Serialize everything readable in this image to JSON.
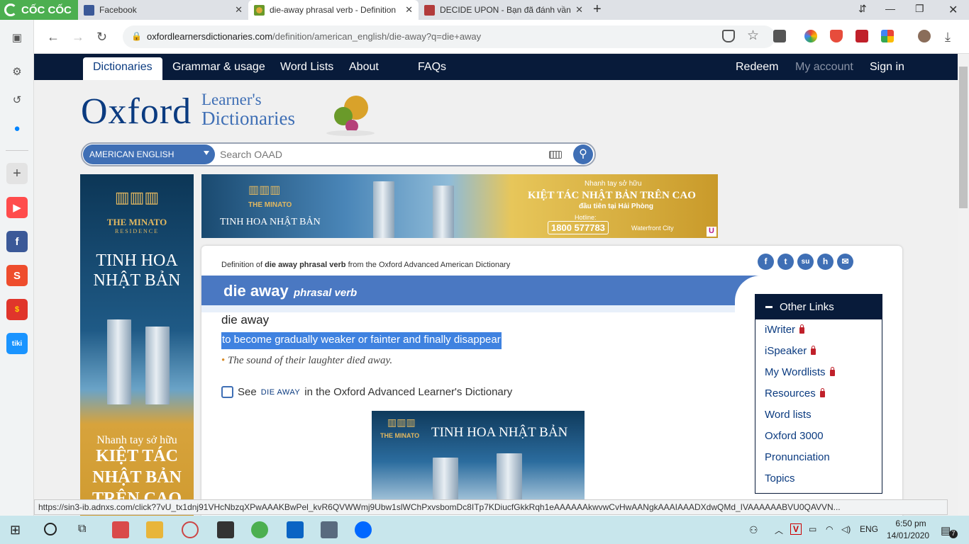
{
  "browser": {
    "logo_text": "CỐC CỐC",
    "tabs": [
      {
        "title": "Facebook",
        "active": false
      },
      {
        "title": "die-away phrasal verb - Definition",
        "active": true
      },
      {
        "title": "DECIDE UPON - Bạn đã đánh vần c",
        "active": false
      }
    ],
    "new_tab": "+",
    "url_host": "oxfordlearnersdictionaries.com",
    "url_path": "/definition/american_english/die-away?q=die+away",
    "status_url": "https://sin3-ib.adnxs.com/click?7vU_tx1dnj91VHcNbzqXPwAAAKBwPel_kvR6QVWWmj9Ubw1slWChPxvsbomDc8ITp7KDiucfGkkRqh1eAAAAAAkwvwCvHwAANgkAAAIAAADXdwQMd_IVAAAAAABVU0QAVVN..."
  },
  "site": {
    "nav": {
      "dictionaries": "Dictionaries",
      "grammar": "Grammar & usage",
      "word_lists": "Word Lists",
      "about": "About",
      "faqs": "FAQs",
      "redeem": "Redeem",
      "my_account": "My account",
      "sign_in": "Sign in"
    },
    "brand": {
      "oxford": "Oxford",
      "learners": "Learner's",
      "dictionaries": "Dictionaries"
    },
    "search": {
      "dictionary": "AMERICAN ENGLISH",
      "placeholder": "Search OAAD"
    }
  },
  "ads": {
    "brand": "THE MINATO",
    "brand_sub": "RESIDENCE",
    "tagline": "TINH HOA NHẬT BẢN",
    "left_big_1": "TINH HOA",
    "left_big_2": "NHẬT BẢN",
    "left_small": "Nhanh tay sở hữu",
    "left_bottom_1": "KIỆT TÁC",
    "left_bottom_2": "NHẬT BẢN",
    "left_bottom_3": "TRÊN CAO",
    "top_small": "Nhanh tay sở hữu",
    "top_headline": "KIỆT TÁC NHẬT BẢN TRÊN CAO",
    "top_sub": "đầu tiên tại Hải Phòng",
    "hotline_label": "Hotline:",
    "hotline": "1800 577783",
    "project": "Waterfront City",
    "badge": "U"
  },
  "entry": {
    "source_prefix": "Definition of",
    "source_word": "die away phrasal verb",
    "source_suffix": "from the Oxford Advanced American Dictionary",
    "headword": "die away",
    "pos": "phrasal verb",
    "sense_headword": "die away",
    "definition": "to become gradually weaker or fainter and finally disappear",
    "example": "The sound of their laughter died away.",
    "see_prefix": "See",
    "see_link": "DIE AWAY",
    "see_suffix": "in the Oxford Advanced Learner's Dictionary",
    "social": [
      "f",
      "t",
      "su",
      "h",
      "✉"
    ]
  },
  "other_links": {
    "title": "Other Links",
    "items": [
      {
        "label": "iWriter",
        "locked": true
      },
      {
        "label": "iSpeaker",
        "locked": true
      },
      {
        "label": "My Wordlists",
        "locked": true
      },
      {
        "label": "Resources",
        "locked": true
      },
      {
        "label": "Word lists",
        "locked": false
      },
      {
        "label": "Oxford 3000",
        "locked": false
      },
      {
        "label": "Pronunciation",
        "locked": false
      },
      {
        "label": "Topics",
        "locked": false
      }
    ]
  },
  "taskbar": {
    "language": "ENG",
    "time": "6:50 pm",
    "date": "14/01/2020",
    "notifications": "7"
  },
  "colors": {
    "nav_bg": "#081b3a",
    "brand_blue": "#0b3b80",
    "accent_blue": "#4a78c2",
    "highlight": "#3f82e0",
    "lock_red": "#c0202a"
  }
}
